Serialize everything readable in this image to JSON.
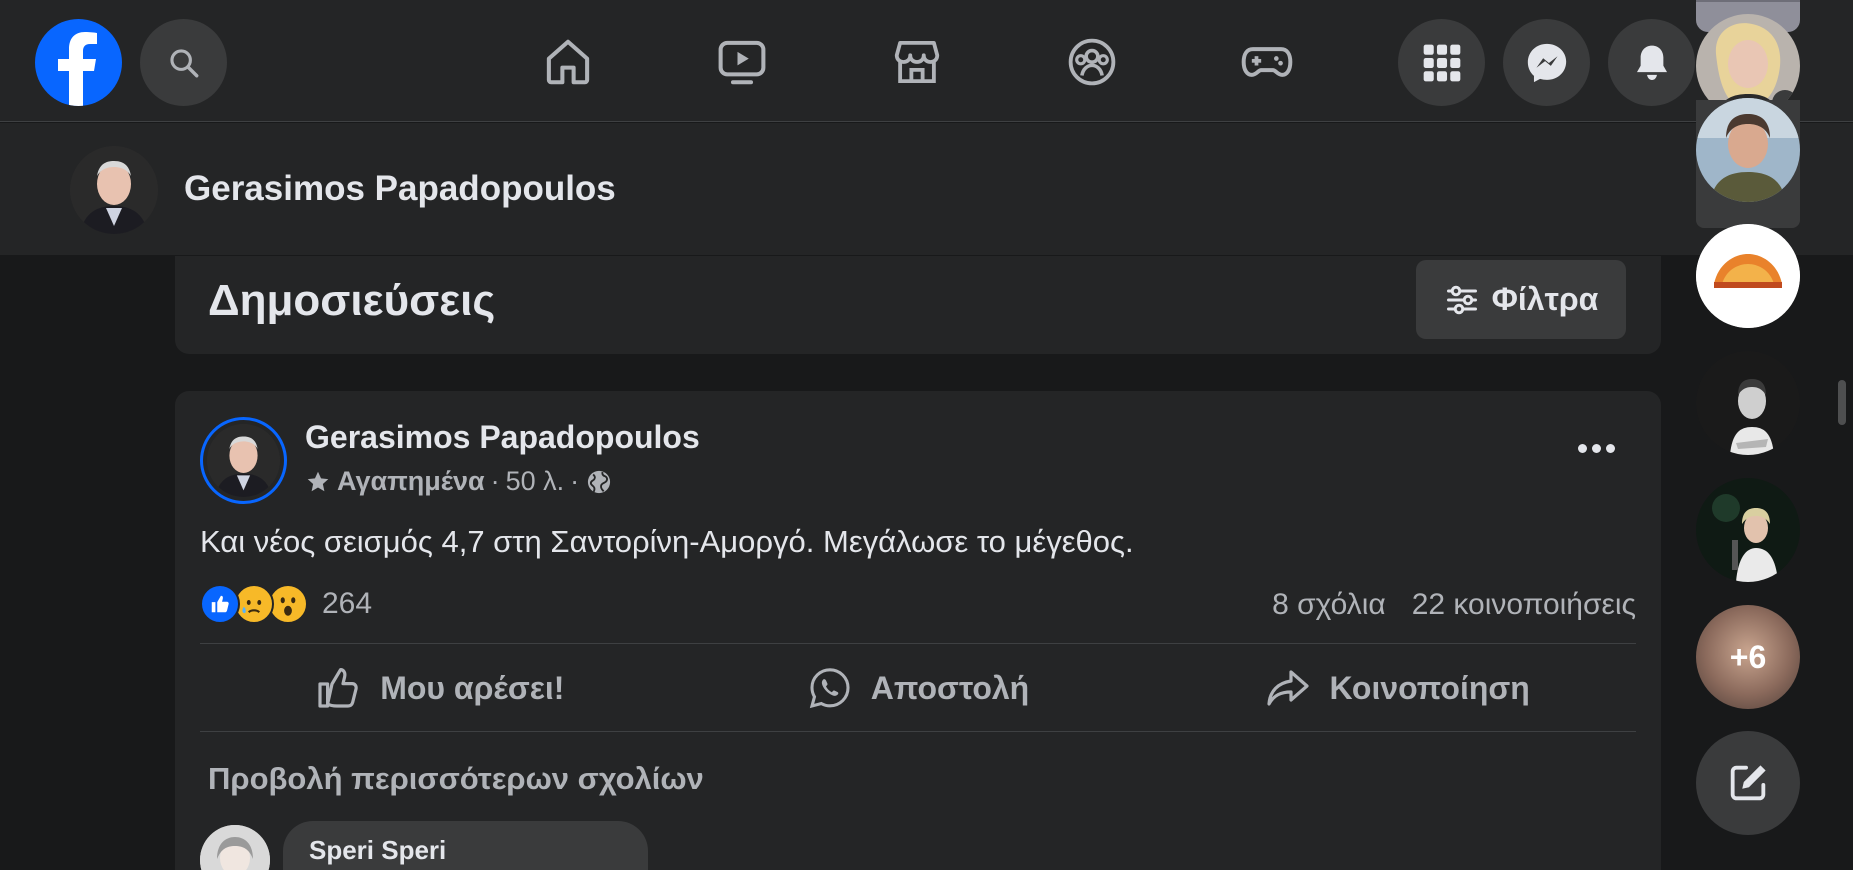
{
  "app": {
    "name": "Facebook"
  },
  "profile": {
    "name": "Gerasimos Papadopoulos"
  },
  "posts_section": {
    "title": "Δημοσιεύσεις",
    "filter_label": "Φίλτρα"
  },
  "post": {
    "author": "Gerasimos Papadopoulos",
    "audience_label": "Αγαπημένα",
    "separator": "·",
    "time": "50 λ.",
    "text": "Και νέος σεισμός 4,7 στη Σαντορίνη-Αμοργό. Μεγάλωσε το μέγεθος.",
    "reaction_count": "264",
    "comments": "8 σχόλια",
    "shares": "22 κοινοποιήσεις",
    "actions": {
      "like": "Μου αρέσει!",
      "send": "Αποστολή",
      "share": "Κοινοποίηση"
    },
    "more_comments": "Προβολή περισσότερων σχολίων",
    "first_comment_author": "Speri Speri"
  },
  "contacts": {
    "more_badge": "+6"
  },
  "colors": {
    "accent": "#0866ff",
    "background": "#18191a",
    "surface": "#242526",
    "secondary_surface": "#3a3b3c",
    "text_primary": "#e4e6eb",
    "text_secondary": "#b0b3b8"
  },
  "icons": [
    "facebook-logo",
    "search-icon",
    "home-icon",
    "video-icon",
    "marketplace-icon",
    "groups-icon",
    "gaming-icon",
    "menu-grid-icon",
    "messenger-icon",
    "bell-icon",
    "filter-icon",
    "star-icon",
    "globe-icon",
    "more-icon",
    "like-icon",
    "whatsapp-icon",
    "share-icon",
    "compose-icon"
  ]
}
